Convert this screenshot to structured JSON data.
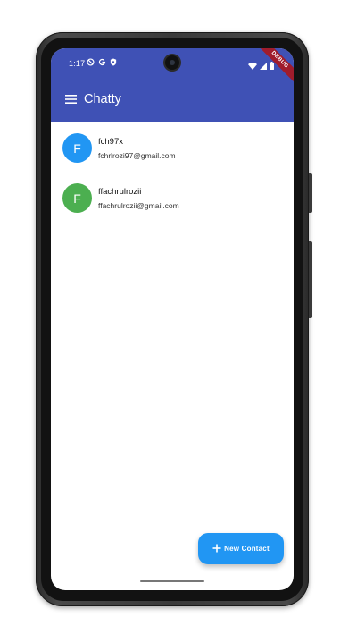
{
  "status_bar": {
    "time": "1:17",
    "left_icons": [
      "do-not-disturb-icon",
      "google-icon",
      "shield-icon"
    ],
    "right_icons": [
      "wifi-icon",
      "cellular-signal-icon",
      "battery-icon"
    ]
  },
  "debug_banner": "DEBUG",
  "app_bar": {
    "title": "Chatty",
    "menu_icon": "hamburger-menu-icon"
  },
  "contacts": [
    {
      "initial": "F",
      "name": "fch97x",
      "email": "fchrlrozi97@gmail.com",
      "avatar_color": "#2196f3"
    },
    {
      "initial": "F",
      "name": "ffachrulrozii",
      "email": "ffachrulrozii@gmail.com",
      "avatar_color": "#4caf50"
    }
  ],
  "fab": {
    "label": "New Contact",
    "icon": "plus-icon"
  },
  "colors": {
    "app_bar": "#3f51b5",
    "fab": "#2196f3",
    "debug_ribbon": "#a01c2c"
  }
}
